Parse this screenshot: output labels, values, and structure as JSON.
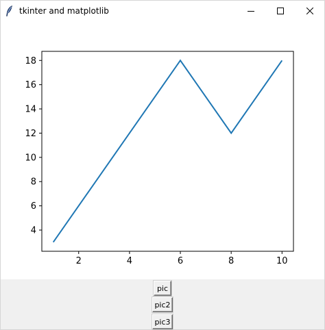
{
  "window": {
    "title": "tkinter and matplotlib",
    "controls": {
      "minimize_icon": "minimize-icon",
      "maximize_icon": "maximize-icon",
      "close_icon": "close-icon"
    }
  },
  "buttons": {
    "pic": "pic",
    "pic2": "pic2",
    "pic3": "pic3"
  },
  "colors": {
    "line": "#1f77b4",
    "panel": "#f0f0f0"
  },
  "chart_data": {
    "type": "line",
    "x": [
      1,
      6,
      8,
      10
    ],
    "series": [
      {
        "values": [
          3,
          18,
          12,
          18
        ]
      }
    ],
    "xlim": [
      0.55,
      10.45
    ],
    "ylim": [
      2.25,
      18.75
    ],
    "xticks": [
      2,
      4,
      6,
      8,
      10
    ],
    "yticks": [
      4,
      6,
      8,
      10,
      12,
      14,
      16,
      18
    ],
    "grid": false
  }
}
